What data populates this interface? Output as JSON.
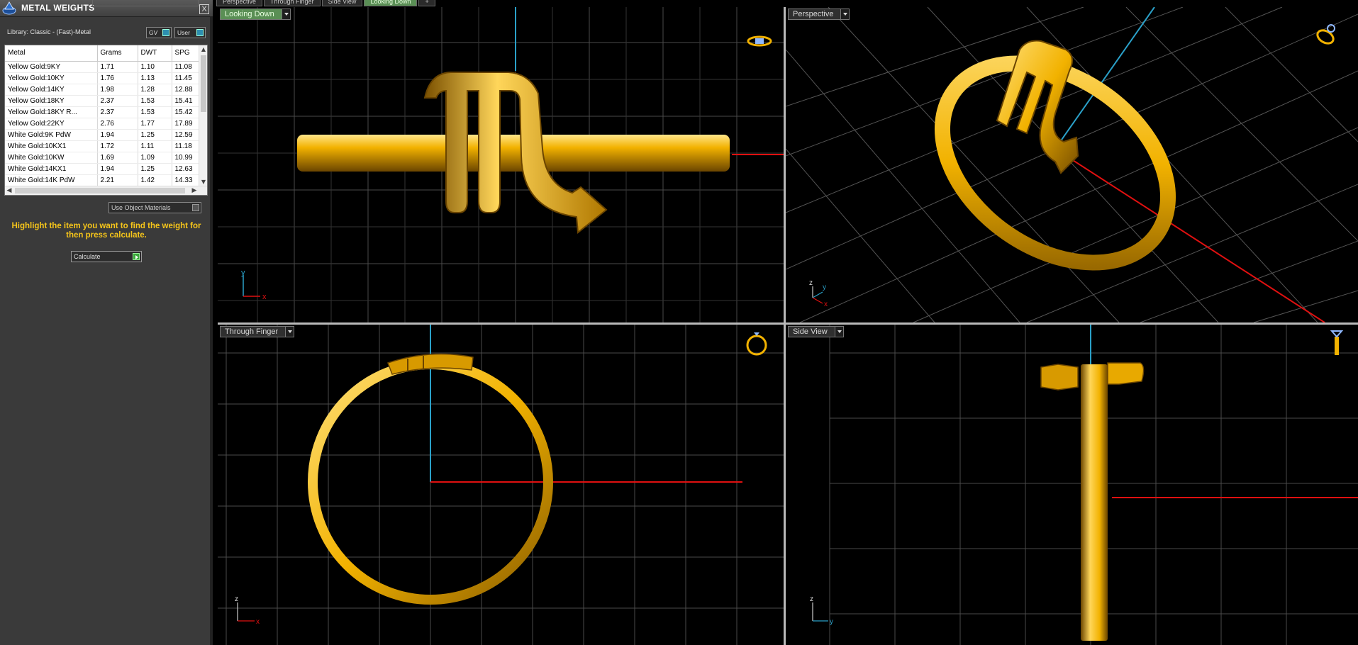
{
  "panel": {
    "title": "METAL WEIGHTS",
    "close": "X",
    "library_label": "Library: Classic - (Fast)-Metal",
    "toggles": {
      "gv": "GV",
      "user": "User"
    },
    "table": {
      "headers": [
        "Metal",
        "Grams",
        "DWT",
        "SPG"
      ],
      "rows": [
        [
          "Yellow Gold:9KY",
          "1.71",
          "1.10",
          "11.08"
        ],
        [
          "Yellow Gold:10KY",
          "1.76",
          "1.13",
          "11.45"
        ],
        [
          "Yellow Gold:14KY",
          "1.98",
          "1.28",
          "12.88"
        ],
        [
          "Yellow Gold:18KY",
          "2.37",
          "1.53",
          "15.41"
        ],
        [
          "Yellow Gold:18KY R...",
          "2.37",
          "1.53",
          "15.42"
        ],
        [
          "Yellow Gold:22KY",
          "2.76",
          "1.77",
          "17.89"
        ],
        [
          "White Gold:9K PdW",
          "1.94",
          "1.25",
          "12.59"
        ],
        [
          "White Gold:10KX1",
          "1.72",
          "1.11",
          "11.18"
        ],
        [
          "White Gold:10KW",
          "1.69",
          "1.09",
          "10.99"
        ],
        [
          "White Gold:14KX1",
          "1.94",
          "1.25",
          "12.63"
        ],
        [
          "White Gold:14K PdW",
          "2.21",
          "1.42",
          "14.33"
        ]
      ]
    },
    "use_object_materials": "Use Object Materials",
    "hint": "Highlight the item you want to find the weight for then press calculate.",
    "calculate": "Calculate"
  },
  "top_tabs": [
    "Perspective",
    "Through Finger",
    "Side View",
    "Looking Down"
  ],
  "active_tab": "Looking Down",
  "add_tab": "+",
  "viewports": {
    "looking_down": {
      "label": "Looking Down",
      "axis_a": "y",
      "axis_b": "x"
    },
    "perspective": {
      "label": "Perspective",
      "axis_a": "z",
      "axis_b": "y",
      "axis_c": "x"
    },
    "through_finger": {
      "label": "Through Finger",
      "axis_a": "z",
      "axis_b": "x"
    },
    "side_view": {
      "label": "Side View",
      "axis_a": "z",
      "axis_b": "y"
    }
  },
  "colors": {
    "gold": "#f2b200",
    "gold_dark": "#8a5d00",
    "grid": "#4a4a4a",
    "axis_red": "#e01010",
    "axis_blue": "#2aa0c8",
    "hint_yellow": "#f6c51a",
    "active_green": "#5a8f55"
  }
}
